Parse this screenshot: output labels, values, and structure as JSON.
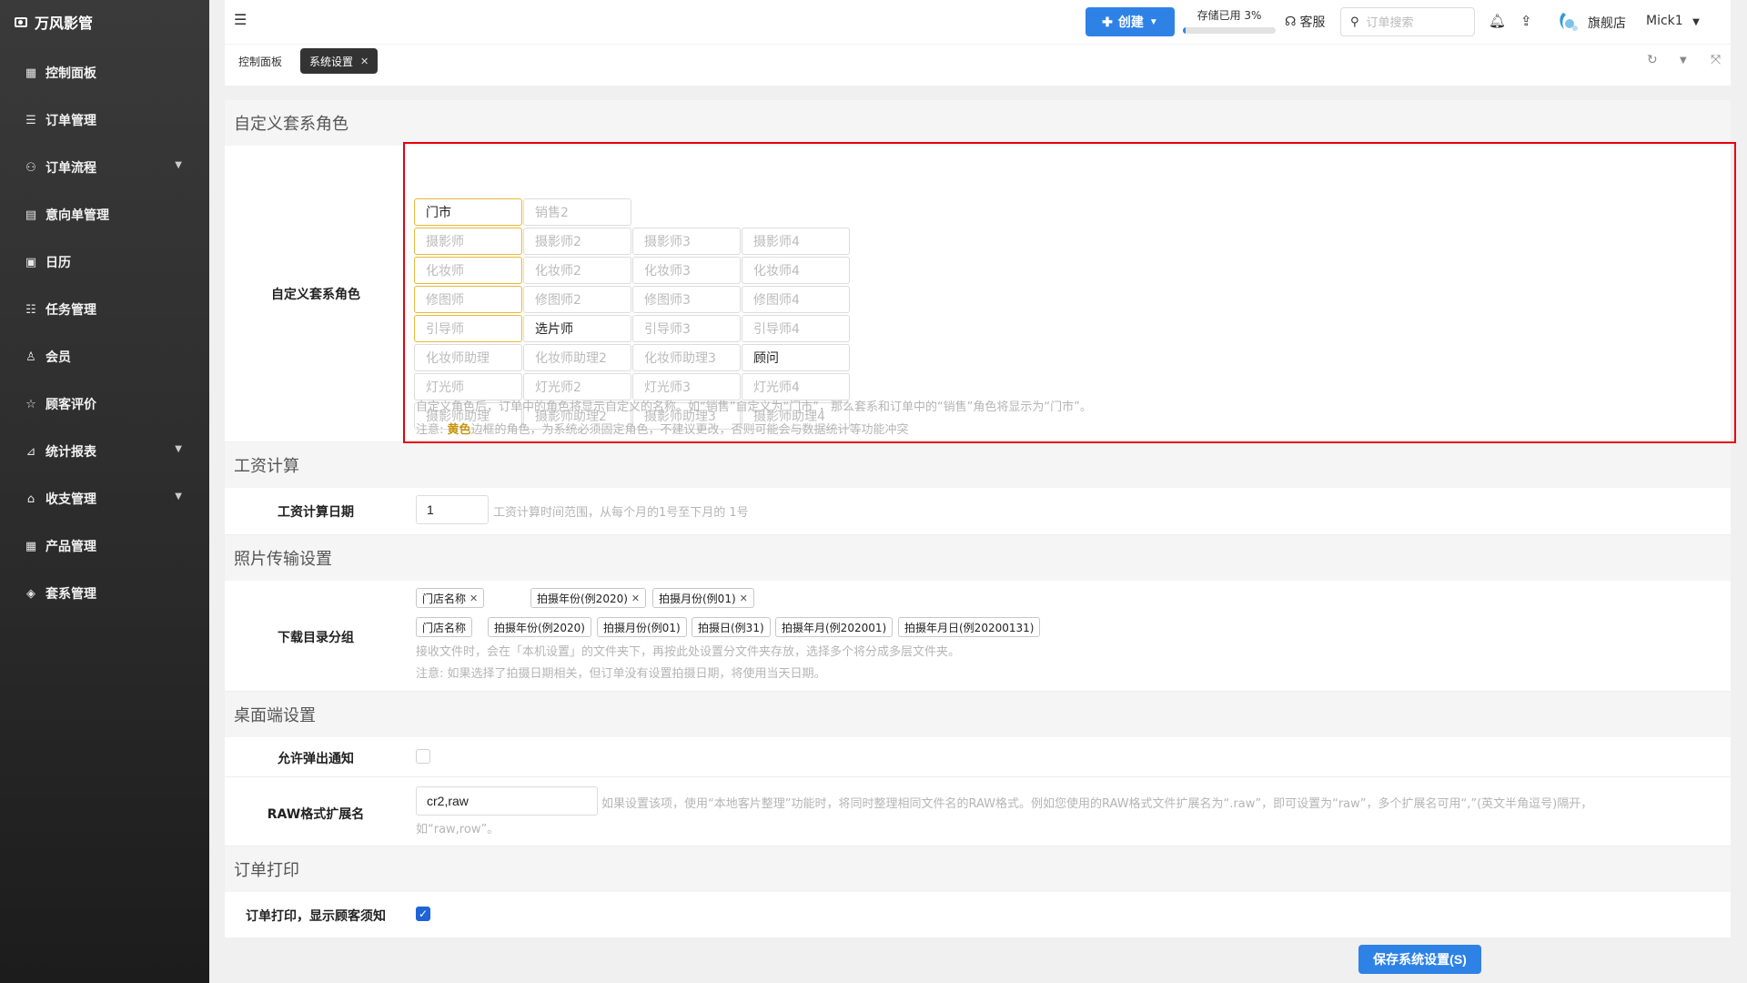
{
  "sidebar": {
    "brand": "万风影管",
    "items": [
      {
        "label": "控制面板",
        "icon": "grid-icon",
        "glyph": "▦",
        "has_sub": false
      },
      {
        "label": "订单管理",
        "icon": "list-icon",
        "glyph": "☰",
        "has_sub": false
      },
      {
        "label": "订单流程",
        "icon": "flow-icon",
        "glyph": "⚇",
        "has_sub": true
      },
      {
        "label": "意向单管理",
        "icon": "document-icon",
        "glyph": "▤",
        "has_sub": false
      },
      {
        "label": "日历",
        "icon": "calendar-icon",
        "glyph": "▣",
        "has_sub": false
      },
      {
        "label": "任务管理",
        "icon": "tasks-icon",
        "glyph": "☷",
        "has_sub": false
      },
      {
        "label": "会员",
        "icon": "user-icon",
        "glyph": "♙",
        "has_sub": false
      },
      {
        "label": "顾客评价",
        "icon": "star-icon",
        "glyph": "☆",
        "has_sub": false
      },
      {
        "label": "统计报表",
        "icon": "chart-icon",
        "glyph": "⊿",
        "has_sub": true
      },
      {
        "label": "收支管理",
        "icon": "bank-icon",
        "glyph": "⌂",
        "has_sub": true
      },
      {
        "label": "产品管理",
        "icon": "product-icon",
        "glyph": "▦",
        "has_sub": false
      },
      {
        "label": "套系管理",
        "icon": "package-icon",
        "glyph": "◈",
        "has_sub": false
      }
    ]
  },
  "header": {
    "create_label": "创建",
    "storage_label": "存储已用 3%",
    "storage_percent": 3,
    "support_label": "客服",
    "search_placeholder": "订单搜索",
    "store_name": "旗舰店",
    "user_name": "Mick1"
  },
  "tabs": [
    {
      "label": "控制面板",
      "active": false
    },
    {
      "label": "系统设置",
      "active": true
    }
  ],
  "sections": {
    "roles": {
      "title": "自定义套系角色",
      "label": "自定义套系角色",
      "rows": [
        [
          {
            "text": "门市",
            "filled": true,
            "yellow": true
          },
          {
            "text": "销售2",
            "filled": false,
            "yellow": false
          }
        ],
        [
          {
            "text": "摄影师",
            "filled": false,
            "yellow": true
          },
          {
            "text": "摄影师2",
            "filled": false,
            "yellow": false
          },
          {
            "text": "摄影师3",
            "filled": false,
            "yellow": false
          },
          {
            "text": "摄影师4",
            "filled": false,
            "yellow": false
          }
        ],
        [
          {
            "text": "化妆师",
            "filled": false,
            "yellow": true
          },
          {
            "text": "化妆师2",
            "filled": false,
            "yellow": false
          },
          {
            "text": "化妆师3",
            "filled": false,
            "yellow": false
          },
          {
            "text": "化妆师4",
            "filled": false,
            "yellow": false
          }
        ],
        [
          {
            "text": "修图师",
            "filled": false,
            "yellow": true
          },
          {
            "text": "修图师2",
            "filled": false,
            "yellow": false
          },
          {
            "text": "修图师3",
            "filled": false,
            "yellow": false
          },
          {
            "text": "修图师4",
            "filled": false,
            "yellow": false
          }
        ],
        [
          {
            "text": "引导师",
            "filled": false,
            "yellow": true
          },
          {
            "text": "选片师",
            "filled": true,
            "yellow": false
          },
          {
            "text": "引导师3",
            "filled": false,
            "yellow": false
          },
          {
            "text": "引导师4",
            "filled": false,
            "yellow": false
          }
        ],
        [
          {
            "text": "化妆师助理",
            "filled": false,
            "yellow": false
          },
          {
            "text": "化妆师助理2",
            "filled": false,
            "yellow": false
          },
          {
            "text": "化妆师助理3",
            "filled": false,
            "yellow": false
          },
          {
            "text": "顾问",
            "filled": true,
            "yellow": false
          }
        ],
        [
          {
            "text": "灯光师",
            "filled": false,
            "yellow": false
          },
          {
            "text": "灯光师2",
            "filled": false,
            "yellow": false
          },
          {
            "text": "灯光师3",
            "filled": false,
            "yellow": false
          },
          {
            "text": "灯光师4",
            "filled": false,
            "yellow": false
          }
        ],
        [
          {
            "text": "摄影师助理",
            "filled": false,
            "yellow": false
          },
          {
            "text": "摄影师助理2",
            "filled": false,
            "yellow": false
          },
          {
            "text": "摄影师助理3",
            "filled": false,
            "yellow": false
          },
          {
            "text": "摄影师助理4",
            "filled": false,
            "yellow": false
          }
        ]
      ],
      "hint1": "自定义角色后，订单中的角色将显示自定义的名称。如“销售”自定义为“门市”，那么套系和订单中的“销售”角色将显示为“门市”。",
      "hint2_prefix": "注意: ",
      "hint2_highlight": "黄色",
      "hint2_suffix": "边框的角色，为系统必须固定角色，不建议更改，否则可能会与数据统计等功能冲突"
    },
    "salary": {
      "title": "工资计算",
      "label": "工资计算日期",
      "value": "1",
      "hint": "工资计算时间范围，从每个月的1号至下月的 1号"
    },
    "photo": {
      "title": "照片传输设置",
      "label": "下载目录分组",
      "selected": [
        "门店名称",
        "拍摄年份(例2020)",
        "拍摄月份(例01)"
      ],
      "options": [
        "门店名称",
        "拍摄年份(例2020)",
        "拍摄月份(例01)",
        "拍摄日(例31)",
        "拍摄年月(例202001)",
        "拍摄年月日(例20200131)"
      ],
      "hint1": "接收文件时，会在「本机设置」的文件夹下，再按此处设置分文件夹存放，选择多个将分成多层文件夹。",
      "hint2": "注意: 如果选择了拍摄日期相关，但订单没有设置拍摄日期，将使用当天日期。"
    },
    "desktop": {
      "title": "桌面端设置",
      "popup_label": "允许弹出通知",
      "popup_checked": false,
      "raw_label": "RAW格式扩展名",
      "raw_value": "cr2,raw",
      "raw_hint1": "如果设置该项，使用“本地客片整理”功能时，将同时整理相同文件名的RAW格式。例如您使用的RAW格式文件扩展名为“.raw”，即可设置为“raw”，多个扩展名可用“,”(英文半角逗号)隔开，",
      "raw_hint2": "如“raw,row”。"
    },
    "print": {
      "title": "订单打印",
      "label": "订单打印，显示顾客须知",
      "checked": true
    }
  },
  "save_label": "保存系统设置(S)",
  "colors": {
    "accent": "#2e82e6",
    "yellow_border": "#e7b93a",
    "highlight_box": "#e8000d"
  }
}
